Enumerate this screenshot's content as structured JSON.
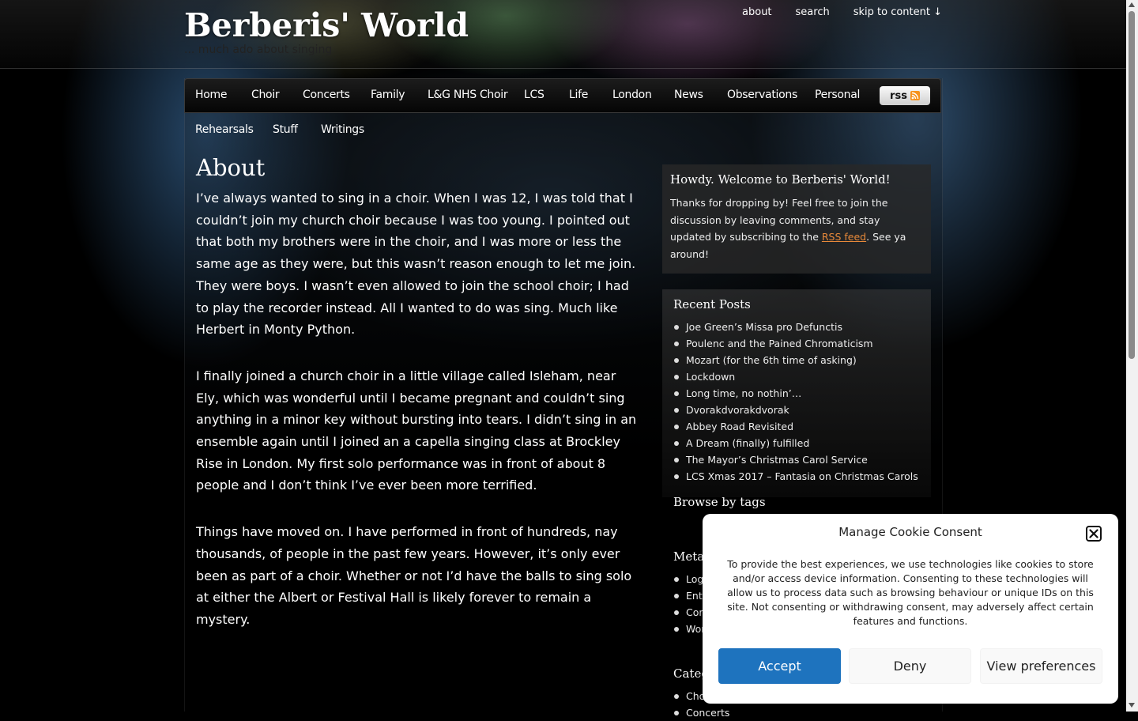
{
  "site": {
    "title": "Berberis' World",
    "tagline": "... much ado about singing"
  },
  "top_links": [
    "about",
    "search",
    "skip to content ↓"
  ],
  "nav": {
    "row1": [
      "Home",
      "Choir",
      "Concerts",
      "Family",
      "L&G NHS Choir",
      "LCS",
      "Life",
      "London",
      "News",
      "Observations",
      "Personal"
    ],
    "row2": [
      "Rehearsals",
      "Stuff",
      "Writings"
    ],
    "rss_label": "rss"
  },
  "page": {
    "title": "About",
    "paragraphs": [
      "I’ve always wanted to sing in a choir. When I was 12, I was told that I couldn’t join my church choir because I was too young. I pointed out that both my brothers were in the choir, and I was more or less the same age as they were, but this wasn’t reason enough to let me join. They were boys. I wasn’t even allowed to join the school choir; I had to play the recorder instead. All I wanted to do was sing. Much like Herbert in Monty Python.",
      "I finally joined a church choir in a little village called Isleham, near Ely, which was wonderful until I became pregnant and couldn’t sing anything in a minor key without bursting into tears. I didn’t sing in an ensemble again until I joined an a capella singing class at Brockley Rise in London. My first solo performance was in front of about 8 people and I don’t think I’ve ever been more terrified.",
      "Things have moved on. I have performed in front of hundreds, nay thousands, of people in the past few years. However, it’s only ever been as part of a choir. Whether or not I’d have the balls to sing solo at either the Albert or Festival Hall is likely forever to remain a mystery."
    ]
  },
  "sidebar": {
    "welcome": {
      "title": "Howdy. Welcome to Berberis' World!",
      "text_before": "Thanks for dropping by! Feel free to join the discussion by leaving comments, and stay updated by subscribing to the ",
      "link": "RSS feed",
      "text_after": ". See ya around!"
    },
    "recent_posts": {
      "title": "Recent Posts",
      "items": [
        "Joe Green’s Missa pro Defunctis",
        "Poulenc and the Pained Chromaticism",
        "Mozart (for the 6th time of asking)",
        "Lockdown",
        "Long time, no nothin’…",
        "Dvorakdvorakdvorak",
        "Abbey Road Revisited",
        "A Dream (finally) fulfilled",
        "The Mayor’s Christmas Carol Service",
        "LCS Xmas 2017 – Fantasia on Christmas Carols"
      ]
    },
    "tags": {
      "title": "Browse by tags"
    },
    "meta": {
      "title": "Meta",
      "items": [
        "Log",
        "Ent",
        "Cor",
        "Wor"
      ]
    },
    "categories": {
      "title": "Categ",
      "items": [
        "Cho",
        "Concerts"
      ]
    }
  },
  "cookie": {
    "title": "Manage Cookie Consent",
    "text": "To provide the best experiences, we use technologies like cookies to store and/or access device information. Consenting to these technologies will allow us to process data such as browsing behaviour or unique IDs on this site. Not consenting or withdrawing consent, may adversely affect certain features and functions.",
    "accept": "Accept",
    "deny": "Deny",
    "preferences": "View preferences"
  },
  "colors": {
    "accept_button": "#1e73be",
    "rss_link": "#e8893a",
    "rss_icon": "#f7931e"
  }
}
